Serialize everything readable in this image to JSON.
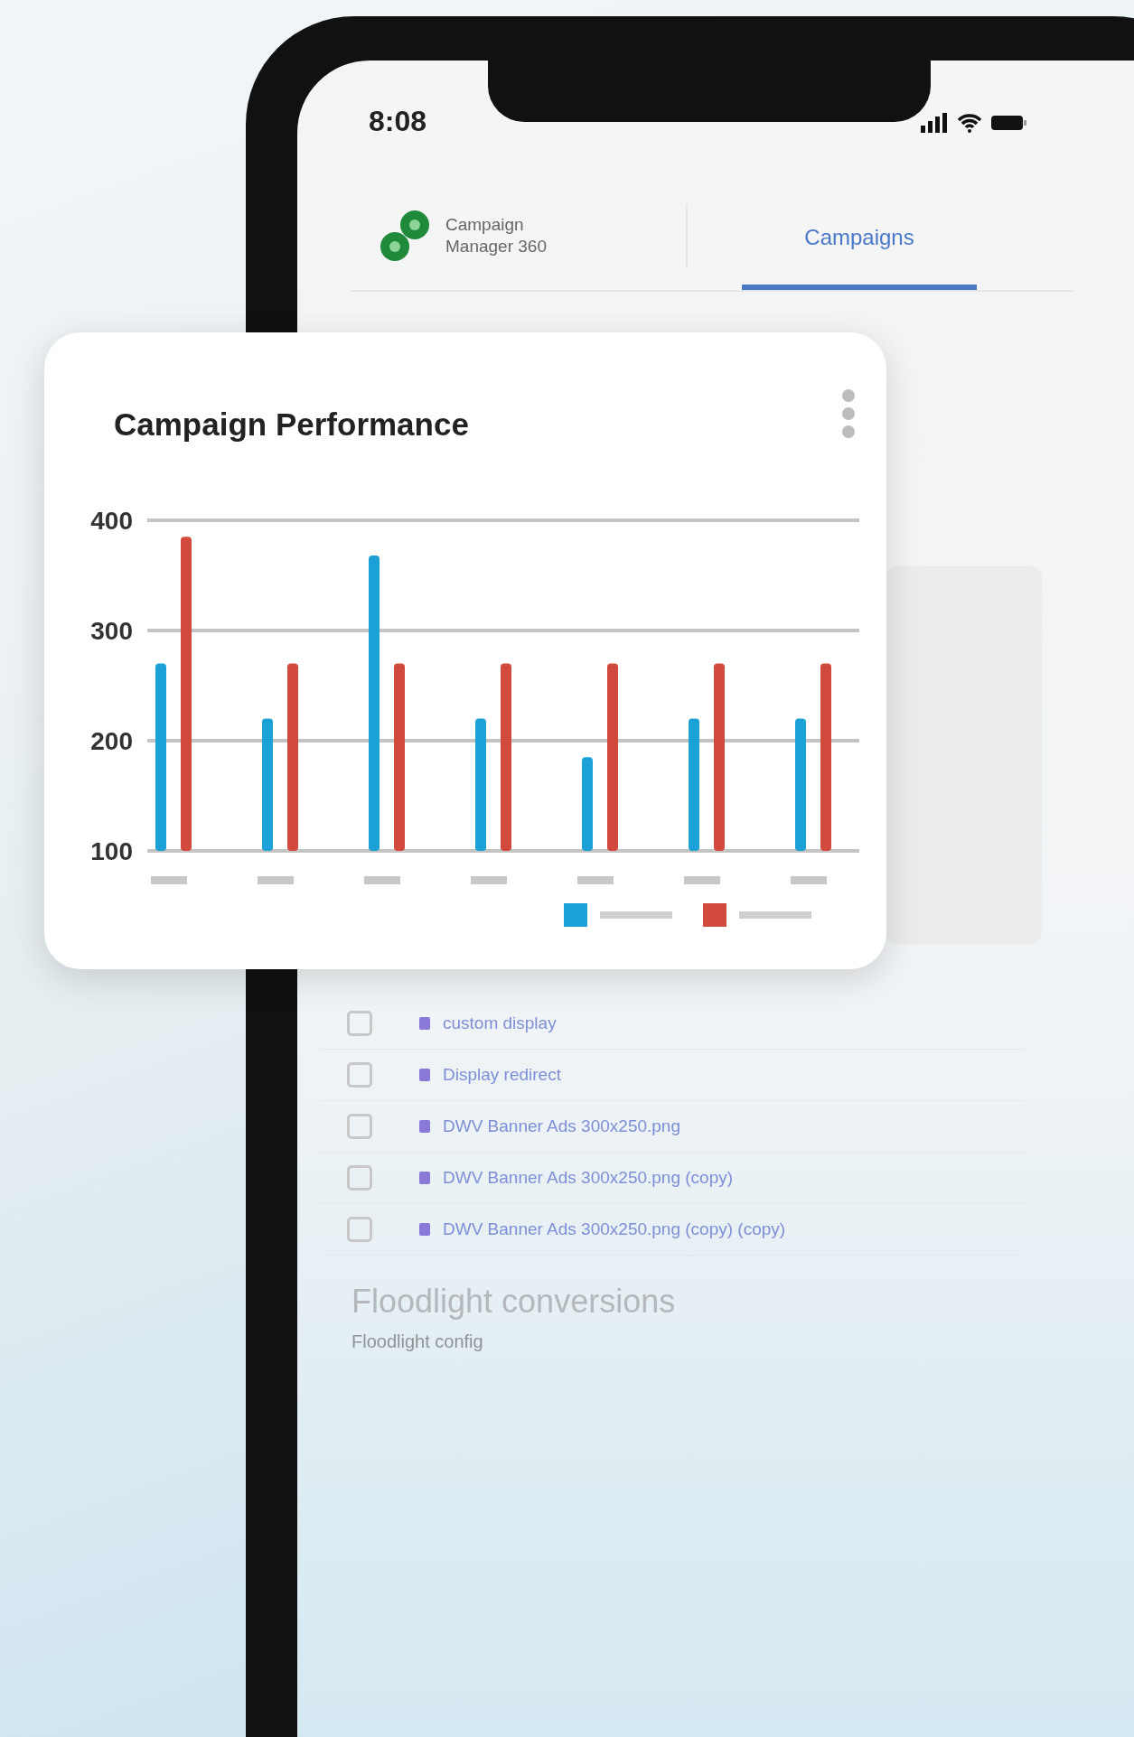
{
  "status_bar": {
    "time": "8:08"
  },
  "header": {
    "app_name": "Campaign Manager 360",
    "tabs": [
      {
        "label": "Campaigns",
        "selected": true
      }
    ]
  },
  "chart_card": {
    "title": "Campaign Performance",
    "chart_data": {
      "type": "bar",
      "ylim": [
        100,
        400
      ],
      "yticks": [
        100,
        200,
        300,
        400
      ],
      "series": [
        {
          "color": "#1ba1d6",
          "values": [
            270,
            220,
            368,
            220,
            185,
            220,
            220
          ]
        },
        {
          "color": "#d24a3d",
          "values": [
            385,
            270,
            270,
            270,
            270,
            270,
            270
          ]
        }
      ]
    }
  },
  "creatives": [
    {
      "name": "custom display",
      "checked": false
    },
    {
      "name": "Display redirect",
      "checked": false
    },
    {
      "name": "DWV Banner Ads 300x250.png",
      "checked": false
    },
    {
      "name": "DWV Banner Ads 300x250.png (copy)",
      "checked": false
    },
    {
      "name": "DWV Banner Ads 300x250.png (copy) (copy)",
      "checked": false
    }
  ],
  "floodlight": {
    "title": "Floodlight conversions",
    "subtitle": "Floodlight config"
  }
}
